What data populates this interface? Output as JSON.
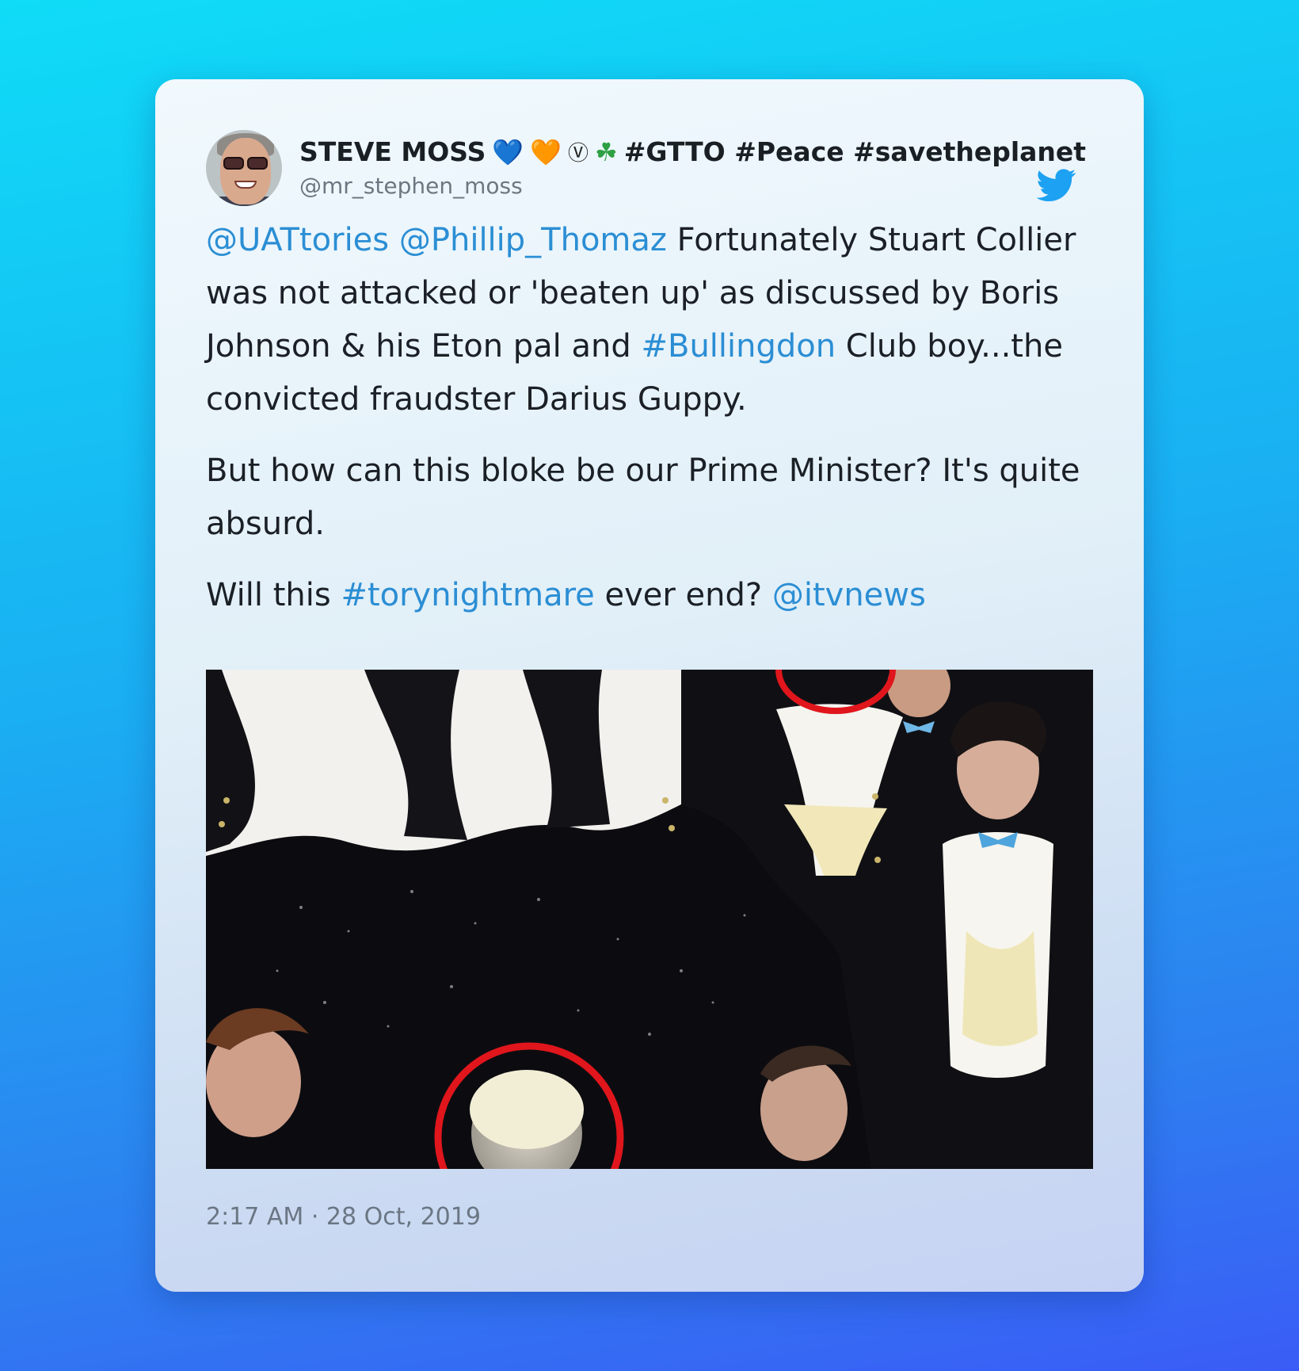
{
  "tweet": {
    "author": {
      "name": "STEVE MOSS",
      "emoji_1": "💙",
      "emoji_2": "🧡",
      "emoji_3": "Ⓥ",
      "emoji_4": "☘",
      "tags": "#GTTO #Peace #savetheplanet",
      "handle": "@mr_stephen_moss"
    },
    "paragraphs": [
      {
        "mention_1": "@UATtories",
        "mention_2": "@Phillip_Thomaz",
        "text_a": " Fortunately Stuart Collier was not attacked or 'beaten up' as discussed by Boris Johnson & his Eton pal and ",
        "hashtag": "#Bullingdon",
        "text_b": " Club boy...the convicted fraudster Darius Guppy."
      },
      {
        "text": "But how can this bloke be our Prime Minister? It's quite absurd."
      },
      {
        "text_a": "Will this ",
        "hashtag": "#torynightmare",
        "text_b": " ever end? ",
        "mention": "@itvnews"
      }
    ],
    "timestamp": "2:17 AM · 28 Oct, 2019"
  },
  "icons": {
    "bird": "twitter-bird-icon",
    "avatar": "user-avatar"
  },
  "colors": {
    "link": "#2b8ed4",
    "text": "#1b2026",
    "timestamp": "#6b7684",
    "bird": "#1da1f2"
  }
}
